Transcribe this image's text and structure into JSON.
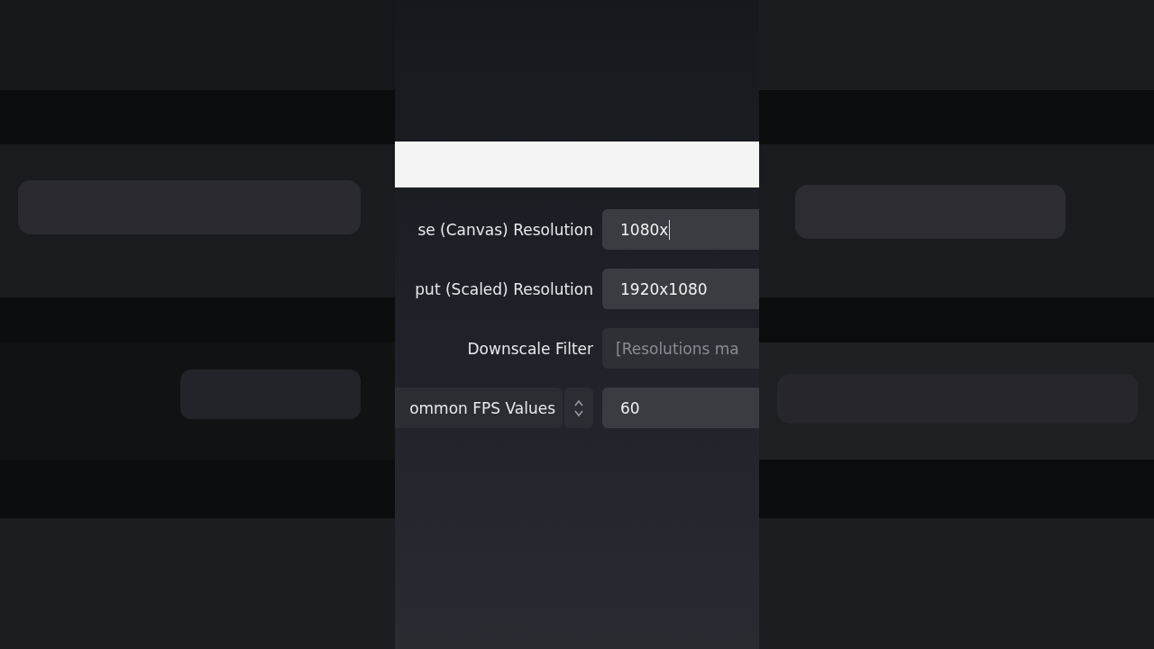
{
  "settings_rows": [
    {
      "kind": "text",
      "label": "se (Canvas) Resolution",
      "value": "1080x",
      "focused": true,
      "disabled": false
    },
    {
      "kind": "text",
      "label": "put (Scaled) Resolution",
      "value": "1920x1080",
      "focused": false,
      "disabled": false
    },
    {
      "kind": "text",
      "label": "Downscale Filter",
      "placeholder": "[Resolutions ma",
      "focused": false,
      "disabled": true
    },
    {
      "kind": "combo",
      "label": "ommon FPS Values",
      "value": "60",
      "focused": false,
      "disabled": false
    }
  ]
}
